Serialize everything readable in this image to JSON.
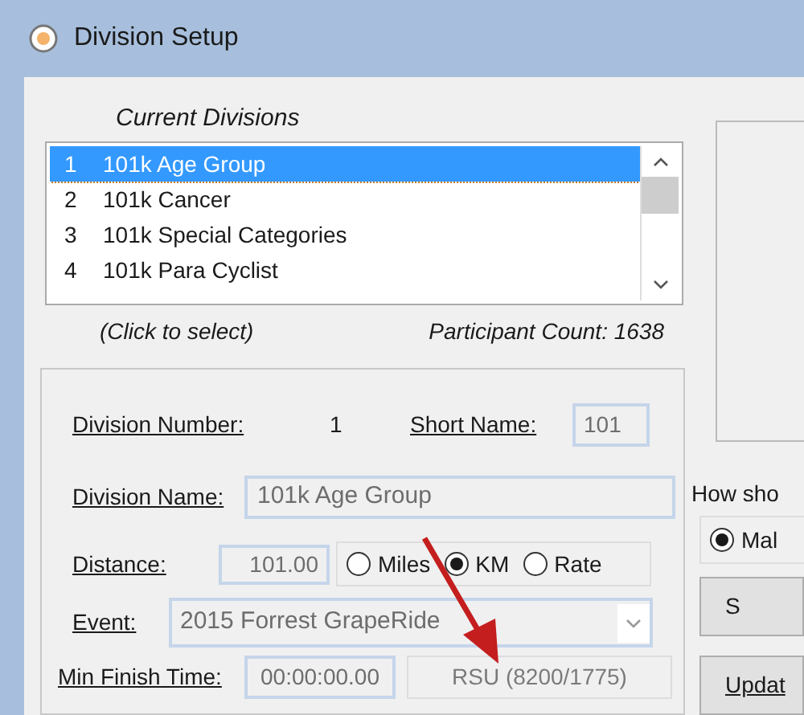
{
  "window": {
    "title": "Division Setup"
  },
  "divisions": {
    "heading": "Current Divisions",
    "items": [
      {
        "number": "1",
        "name": "101k Age Group",
        "selected": true
      },
      {
        "number": "2",
        "name": "101k Cancer",
        "selected": false
      },
      {
        "number": "3",
        "name": "101k Special Categories",
        "selected": false
      },
      {
        "number": "4",
        "name": "101k Para Cyclist",
        "selected": false
      }
    ],
    "hint": "(Click to select)",
    "participant_count": "Participant Count: 1638"
  },
  "form": {
    "division_number_label": "Division Number:",
    "division_number": "1",
    "short_name_label": "Short Name:",
    "short_name": "101",
    "division_name_label": "Division Name:",
    "division_name": "101k Age Group",
    "distance_label": "Distance:",
    "distance": "101.00",
    "units": [
      {
        "label": "Miles",
        "selected": false
      },
      {
        "label": "KM",
        "selected": true
      },
      {
        "label": "Rate",
        "selected": false
      }
    ],
    "event_label": "Event:",
    "event": "2015 Forrest GrapeRide",
    "min_finish_label": "Min Finish Time:",
    "min_finish_time": "00:00:00.00",
    "rsu": "RSU (8200/1775)"
  },
  "right": {
    "question": "How sho",
    "gender_options": [
      {
        "label": "Mal",
        "selected": true
      }
    ],
    "buttons": [
      "S",
      "Updat"
    ]
  }
}
